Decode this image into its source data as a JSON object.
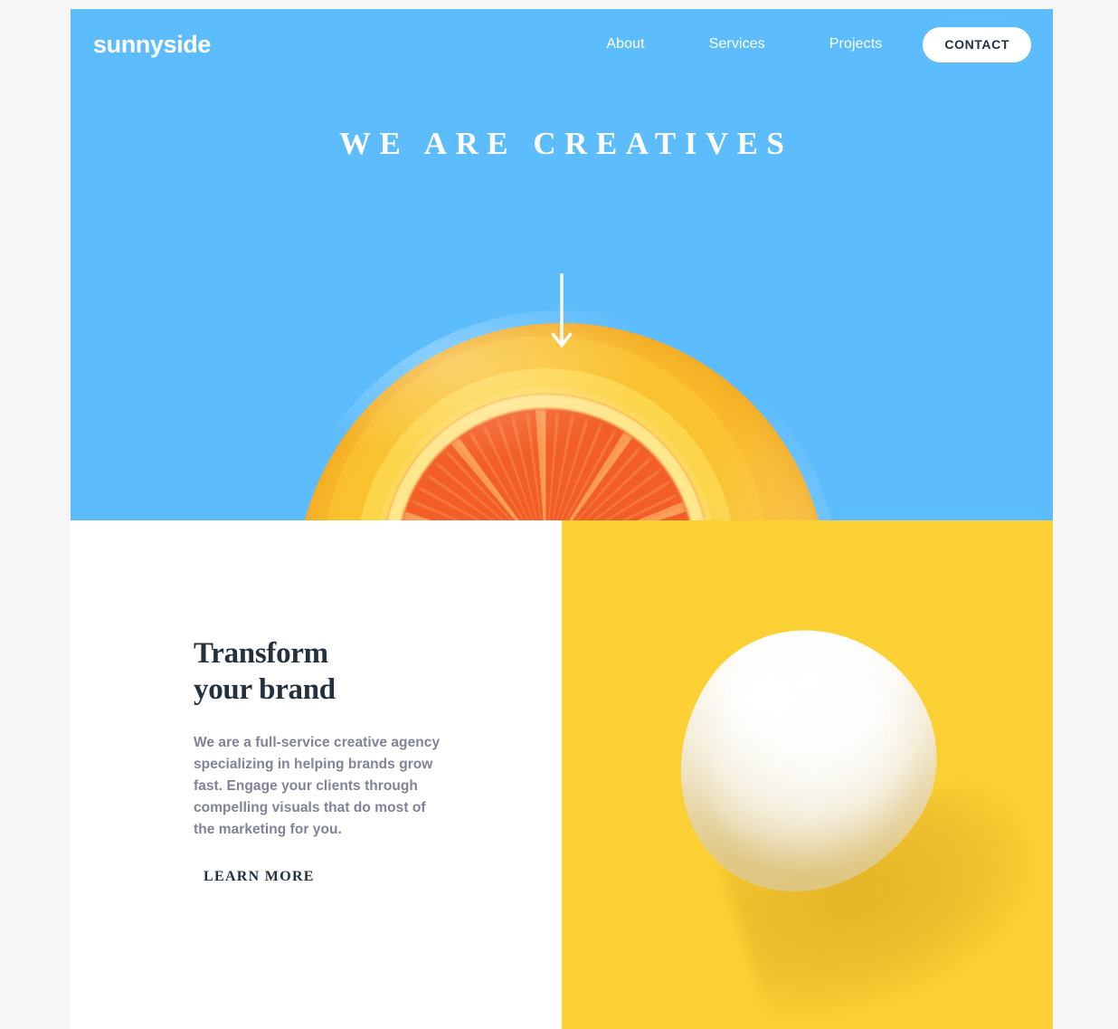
{
  "site": {
    "logo": "sunnyside",
    "colors": {
      "sky": "#5cbcfc",
      "yellow_panel": "#fad034",
      "underline_yellow": "#fad400",
      "heading_navy": "#23303e",
      "body_gray": "#808397",
      "page_background": "#f6f6f6"
    }
  },
  "nav": {
    "items": [
      {
        "label": "About"
      },
      {
        "label": "Services"
      },
      {
        "label": "Projects"
      }
    ],
    "cta": {
      "label": "CONTACT"
    }
  },
  "hero": {
    "title": "WE ARE CREATIVES",
    "scroll_icon": "down-arrow-icon",
    "image_alt": "glass of orange juice with orange slice"
  },
  "transform": {
    "heading": "Transform\nyour brand",
    "body": "We are a full-service creative agency specializing in helping brands grow fast. Engage your clients through compelling visuals that do most of the marketing for you.",
    "link": "LEARN MORE",
    "image_alt": "white egg on yellow background"
  }
}
